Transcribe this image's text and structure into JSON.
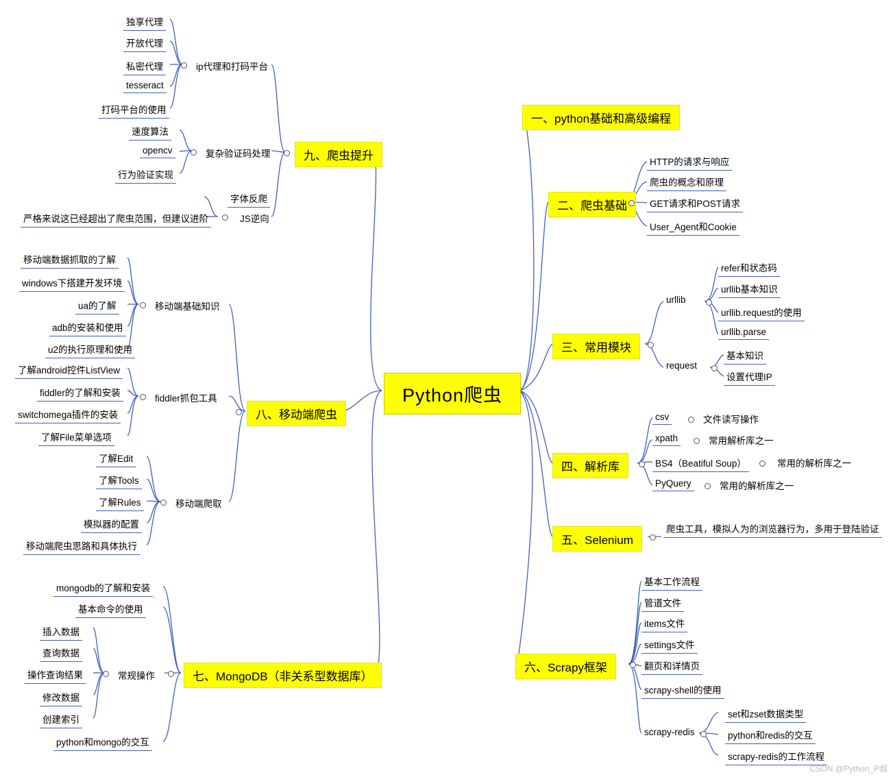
{
  "root": {
    "label": "Python爬虫"
  },
  "watermark": "CSDN @Python_P叔",
  "branches": {
    "b1": {
      "label": "一、python基础和高级编程"
    },
    "b2": {
      "label": "二、爬虫基础",
      "items": [
        "HTTP的请求与响应",
        "爬虫的概念和原理",
        "GET请求和POST请求",
        "User_Agent和Cookie"
      ]
    },
    "b3": {
      "label": "三、常用模块",
      "groups": [
        {
          "label": "urllib",
          "items": [
            "refer和状态码",
            "urllib基本知识",
            "urllib.request的使用",
            "urllib.parse"
          ]
        },
        {
          "label": "request",
          "items": [
            "基本知识",
            "设置代理IP"
          ]
        }
      ]
    },
    "b4": {
      "label": "四、解析库",
      "items": [
        {
          "label": "csv",
          "note": "文件读写操作"
        },
        {
          "label": "xpath",
          "note": "常用解析库之一"
        },
        {
          "label": "BS4（Beatiful Soup）",
          "note": "常用的解析库之一"
        },
        {
          "label": "PyQuery",
          "note": "常用的解析库之一"
        }
      ]
    },
    "b5": {
      "label": "五、Selenium",
      "note": "爬虫工具，模拟人为的浏览器行为，多用于登陆验证"
    },
    "b6": {
      "label": "六、Scrapy框架",
      "items": [
        "基本工作流程",
        "管道文件",
        "items文件",
        "settings文件",
        "翻页和详情页",
        "scrapy-shell的使用"
      ],
      "sub": {
        "label": "scrapy-redis",
        "items": [
          "set和zset数据类型",
          "python和redis的交互",
          "scrapy-redis的工作流程"
        ]
      }
    },
    "b7": {
      "label": "七、MongoDB（非关系型数据库）",
      "items": [
        "mongodb的了解和安装",
        "基本命令的使用"
      ],
      "group": {
        "label": "常规操作",
        "items": [
          "插入数据",
          "查询数据",
          "操作查询结果",
          "修改数据",
          "创建索引"
        ]
      },
      "tail": "python和mongo的交互"
    },
    "b8": {
      "label": "八、移动端爬虫",
      "groups": [
        {
          "label": "移动端基础知识",
          "items": [
            "移动端数据抓取的了解",
            "windows下搭建开发环境",
            "ua的了解",
            "adb的安装和使用",
            "u2的执行原理和使用"
          ]
        },
        {
          "label": "fiddler抓包工具",
          "items": [
            "了解android控件ListView",
            "fiddler的了解和安装",
            "switchomega插件的安装",
            "了解File菜单选项"
          ]
        },
        {
          "label": "移动端爬取",
          "items": [
            "了解Edit",
            "了解Tools",
            "了解Rules",
            "模拟器的配置",
            "移动端爬虫思路和具体执行"
          ]
        }
      ]
    },
    "b9": {
      "label": "九、爬虫提升",
      "groups": [
        {
          "label": "ip代理和打码平台",
          "items": [
            "独享代理",
            "开放代理",
            "私密代理",
            "tesseract",
            "打码平台的使用"
          ]
        },
        {
          "label": "复杂验证码处理",
          "items": [
            "速度算法",
            "opencv",
            "行为验证实现"
          ]
        },
        {
          "label": "JS逆向",
          "items": [
            "字体反爬"
          ],
          "note": "严格来说这已经超出了爬虫范围，但建议进阶"
        }
      ]
    }
  }
}
